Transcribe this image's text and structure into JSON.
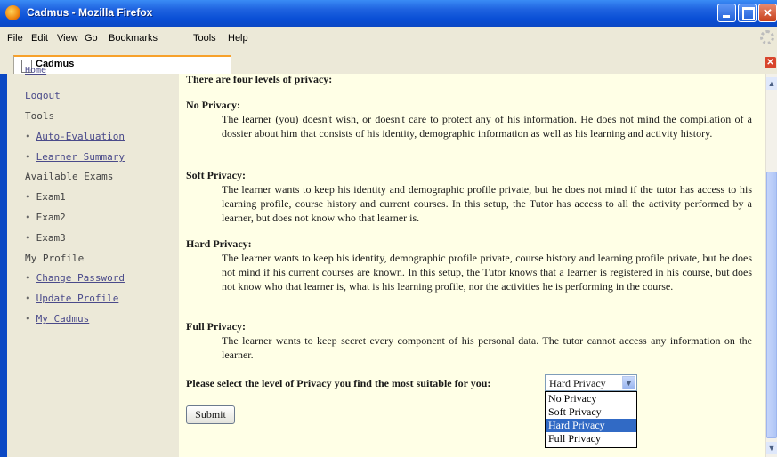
{
  "window": {
    "title": "Cadmus - Mozilla Firefox"
  },
  "menu": [
    "File",
    "Edit",
    "View",
    "Go",
    "Bookmarks",
    "Tools",
    "Help"
  ],
  "tab": {
    "label": "Cadmus"
  },
  "sidebar": {
    "home": "Home",
    "logout": "Logout",
    "tools_header": "Tools",
    "auto_evaluation": "Auto-Evaluation",
    "learner_summary": "Learner Summary",
    "exams_header": "Available Exams",
    "exam1": "Exam1",
    "exam2": "Exam2",
    "exam3": "Exam3",
    "profile_header": "My Profile",
    "change_password": "Change Password",
    "update_profile": "Update Profile",
    "my_cadmus": "My Cadmus",
    "bullet": "•"
  },
  "content": {
    "intro": "There are four levels of privacy:",
    "sections": [
      {
        "title": "No Privacy",
        "body": "The learner (you) doesn't wish, or doesn't care to protect any of his information. He does not mind the compilation of a dossier about him that consists of his identity, demographic information as well as his learning and activity history."
      },
      {
        "title": "Soft Privacy",
        "body": "The learner wants to keep his identity and demographic profile private, but he does not mind if the tutor has access to his learning profile, course history and current courses. In this setup, the Tutor has access to all the activity performed by a learner, but does not know who that learner is."
      },
      {
        "title": "Hard Privacy",
        "body": "The learner wants to keep his identity, demographic profile private, course history and learning profile private, but he does not mind if his current courses are known. In this setup, the Tutor knows that a learner is registered in his course, but does not know who that learner is, what is his learning profile, nor the activities he is performing in the course."
      },
      {
        "title": "Full Privacy",
        "body": "The learner wants to keep secret every component of his personal data. The tutor cannot access any information on the learner."
      }
    ],
    "prompt": "Please select the level of Privacy you find the most suitable for you:",
    "select_value": "Hard Privacy",
    "options": [
      "No Privacy",
      "Soft Privacy",
      "Hard Privacy",
      "Full Privacy"
    ],
    "submit_label": "Submit"
  },
  "colors": {
    "content_bg": "#ffffe6",
    "sidebar_bg": "#ece9d8",
    "selected_option": "#316ac5"
  }
}
